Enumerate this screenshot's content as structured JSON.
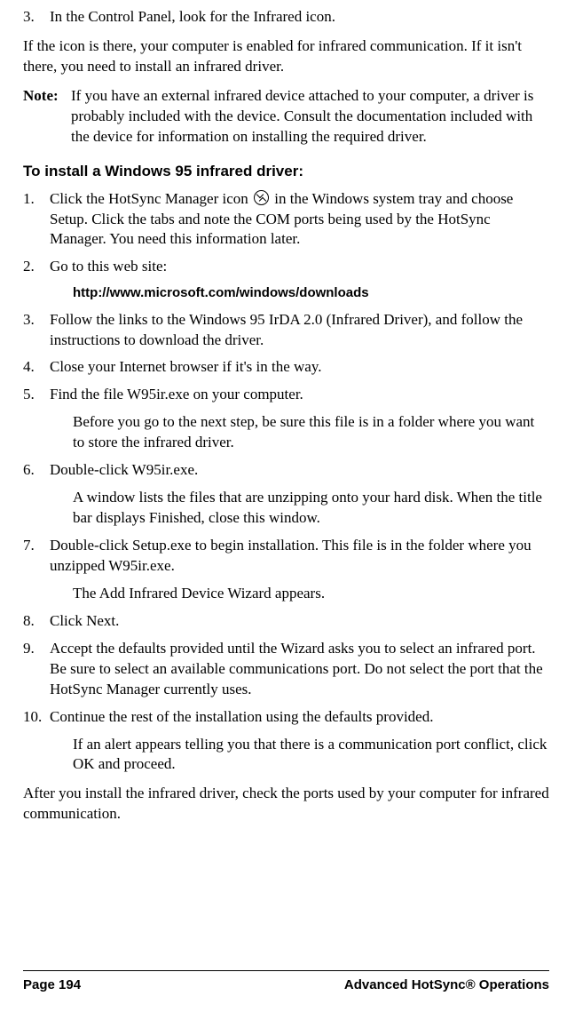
{
  "top_step": {
    "num": "3.",
    "text": "In the Control Panel, look for the Infrared icon."
  },
  "intro_para": "If the icon is there, your computer is enabled for infrared communication. If it isn't there, you need to install an infrared driver.",
  "note": {
    "label": "Note:",
    "text": "If you have an external infrared device attached to your computer, a driver is probably included with the device. Consult the documentation included with the device for information on installing the required driver."
  },
  "heading": "To install a Windows 95 infrared driver:",
  "steps": [
    {
      "num": "1.",
      "pre": "Click the HotSync Manager icon ",
      "post": " in the Windows system tray and choose Setup. Click the tabs and note the COM ports being used by the HotSync Manager. You need this information later."
    },
    {
      "num": "2.",
      "text": "Go to this web site:",
      "inset_url": "http://www.microsoft.com/windows/downloads"
    },
    {
      "num": "3.",
      "text": "Follow the links to the Windows 95 IrDA 2.0 (Infrared Driver), and follow the instructions to download the driver."
    },
    {
      "num": "4.",
      "text": "Close your Internet browser if it's in the way."
    },
    {
      "num": "5.",
      "text": "Find the file W95ir.exe on your computer.",
      "inset": "Before you go to the next step, be sure this file is in a folder where you want to store the infrared driver."
    },
    {
      "num": "6.",
      "text": " Double-click W95ir.exe.",
      "inset": "A window lists the files that are unzipping onto your hard disk. When the title bar displays Finished, close this window."
    },
    {
      "num": "7.",
      "text": "Double-click Setup.exe to begin installation. This file is in the folder where you unzipped W95ir.exe.",
      "inset": "The Add Infrared Device Wizard appears."
    },
    {
      "num": "8.",
      "text": "Click Next."
    },
    {
      "num": "9.",
      "text": "Accept the defaults provided until the Wizard asks you to select an infrared port. Be sure to select an available communications port. Do not select the port that the HotSync Manager currently uses."
    },
    {
      "num": "10.",
      "text": "Continue the rest of the installation using the defaults provided.",
      "inset": "If an alert appears telling you that there is a communication port conflict, click OK and proceed."
    }
  ],
  "closing_para": "After you install the infrared driver, check the ports used by your computer for infrared communication.",
  "footer": {
    "left": "Page 194",
    "right": "Advanced HotSync® Operations"
  }
}
